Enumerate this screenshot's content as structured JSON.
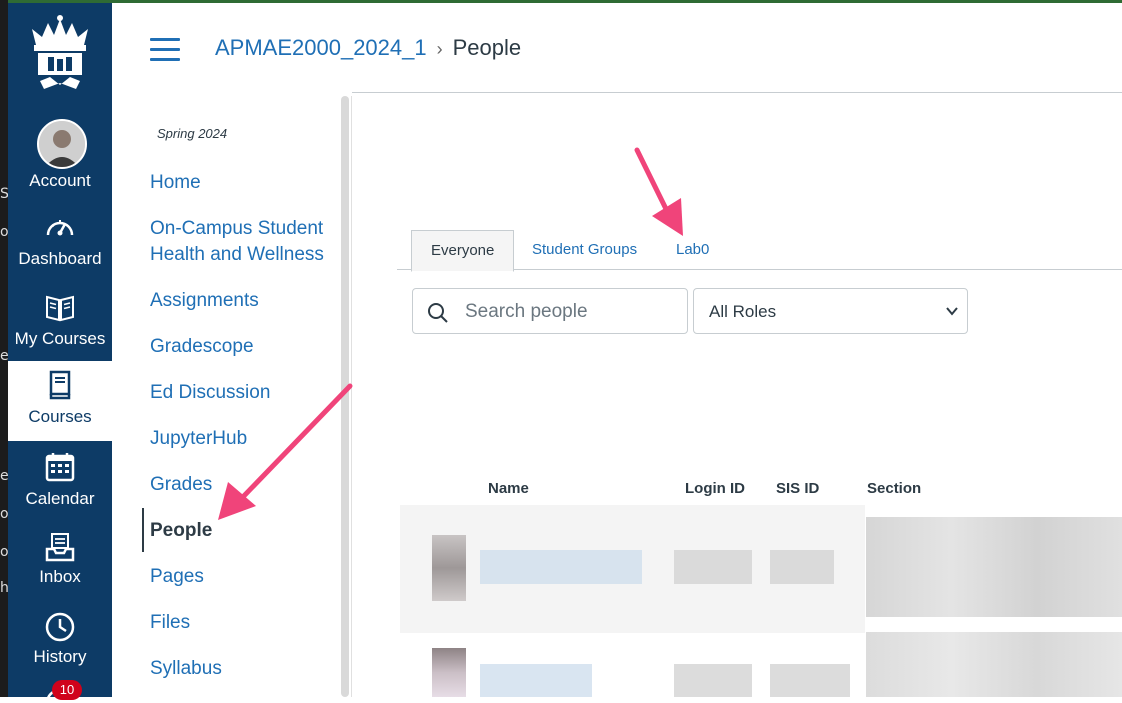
{
  "desktop_edge": {
    "chars": [
      "S",
      "o",
      "e",
      "e",
      "o",
      "o",
      "h"
    ]
  },
  "global_nav": {
    "items": [
      {
        "label": "Account",
        "icon": "avatar-icon"
      },
      {
        "label": "Dashboard",
        "icon": "dashboard-icon"
      },
      {
        "label": "My Courses",
        "icon": "book-icon"
      },
      {
        "label": "Courses",
        "icon": "courses-icon",
        "active": true
      },
      {
        "label": "Calendar",
        "icon": "calendar-icon"
      },
      {
        "label": "Inbox",
        "icon": "inbox-icon"
      },
      {
        "label": "History",
        "icon": "clock-icon"
      }
    ],
    "badge": "10",
    "brand_color": "#0d3b66"
  },
  "header": {
    "course": "APMAE2000_2024_1",
    "separator": "›",
    "current": "People"
  },
  "course_nav": {
    "term": "Spring 2024",
    "items": [
      {
        "label": "Home"
      },
      {
        "label": "On-Campus Student Health and Wellness"
      },
      {
        "label": "Assignments"
      },
      {
        "label": "Gradescope"
      },
      {
        "label": "Ed Discussion"
      },
      {
        "label": "JupyterHub"
      },
      {
        "label": "Grades"
      },
      {
        "label": "People",
        "active": true
      },
      {
        "label": "Pages"
      },
      {
        "label": "Files"
      },
      {
        "label": "Syllabus"
      }
    ],
    "link_color": "#1f6fb5"
  },
  "tabs": [
    {
      "label": "Everyone",
      "active": true
    },
    {
      "label": "Student Groups"
    },
    {
      "label": "Lab0"
    }
  ],
  "search": {
    "placeholder": "Search people",
    "value": ""
  },
  "roles_select": {
    "selected": "All Roles"
  },
  "table": {
    "columns": [
      "Name",
      "Login ID",
      "SIS ID",
      "Section"
    ]
  },
  "annotation_color": "#f0447a"
}
